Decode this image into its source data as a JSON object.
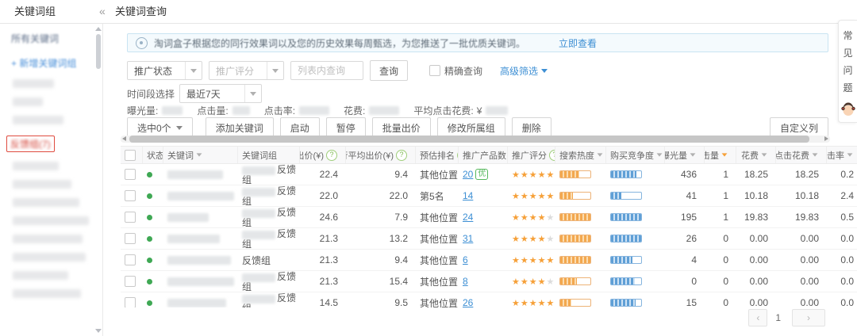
{
  "icons": {
    "help_glyph": "?",
    "status_dot_color": "#3fa854",
    "star_color": "#f6a038",
    "link_color": "#3d8fd4"
  },
  "header": {
    "sidebar_title": "关键词组",
    "collapse_icon": "«",
    "page_title": "关键词查询"
  },
  "sidebar": {
    "all_keywords": "所有关键词",
    "new_group": "+ 新增关键词组",
    "highlighted_item": "反馈组(7)"
  },
  "help_tab": {
    "label": "常见问题"
  },
  "banner": {
    "text": "淘词盒子根据您的同行效果词以及您的历史效果每周甄选，为您推送了一批优质关键词。",
    "link": "立即查看"
  },
  "filters": {
    "status_value": "推广状态",
    "score_placeholder": "推广评分",
    "search_placeholder": "列表内查询",
    "query_button": "查询",
    "exact_label": "精确查询",
    "advanced_label": "高级筛选",
    "time_label": "时间段选择",
    "time_value": "最近7天"
  },
  "summary": {
    "impressions_label": "曝光量:",
    "clicks_label": "点击量:",
    "ctr_label": "点击率:",
    "cost_label": "花费:",
    "avg_cost_label": "平均点击花费:",
    "currency": "¥"
  },
  "toolbar": {
    "selected_label": "选中0个",
    "buttons": [
      "添加关键词",
      "启动",
      "暂停",
      "批量出价",
      "修改所属组",
      "删除"
    ],
    "customize_label": "自定义列"
  },
  "table": {
    "columns": [
      {
        "key": "checkbox",
        "label": ""
      },
      {
        "key": "status",
        "label": "状态"
      },
      {
        "key": "keyword",
        "label": "关键词",
        "sort": "grey"
      },
      {
        "key": "group",
        "label": "关键词组"
      },
      {
        "key": "bid",
        "label": "出价(¥)",
        "help": true,
        "align": "right"
      },
      {
        "key": "peer_bid",
        "label": "同行平均出价(¥)",
        "help": true,
        "align": "right"
      },
      {
        "key": "rank",
        "label": "预估排名",
        "help": true
      },
      {
        "key": "products",
        "label": "推广产品数",
        "help": true
      },
      {
        "key": "score",
        "label": "推广评分",
        "help": true
      },
      {
        "key": "heat",
        "label": "搜索热度",
        "sort": "grey",
        "help": true
      },
      {
        "key": "competition",
        "label": "购买竞争度",
        "sort": "grey",
        "help": true
      },
      {
        "key": "impressions",
        "label": "曝光量",
        "sort": "grey",
        "align": "right"
      },
      {
        "key": "clicks",
        "label": "点击量",
        "sort": "orange",
        "align": "right"
      },
      {
        "key": "cost",
        "label": "花费",
        "sort": "grey",
        "align": "right"
      },
      {
        "key": "avg_cost",
        "label": "平均点击花费",
        "sort": "grey",
        "align": "right"
      },
      {
        "key": "ctr",
        "label": "点击率",
        "sort": "grey",
        "align": "right"
      }
    ],
    "group_suffix": "反馈组",
    "rows": [
      {
        "kw_blur_w": 70,
        "group_blurred": true,
        "bid": "22.4",
        "peer_bid": "9.4",
        "rank": "其他位置",
        "products": "20",
        "badge": "优",
        "stars": 5,
        "heat": 62,
        "competition": 84,
        "impressions": "436",
        "clicks": "1",
        "cost": "18.25",
        "avg_cost": "18.25",
        "ctr": "0.2"
      },
      {
        "kw_blur_w": 84,
        "group_blurred": true,
        "bid": "22.0",
        "peer_bid": "22.0",
        "rank": "第5名",
        "products": "14",
        "badge": "",
        "stars": 5,
        "heat": 42,
        "competition": 33,
        "impressions": "41",
        "clicks": "1",
        "cost": "10.18",
        "avg_cost": "10.18",
        "ctr": "2.4"
      },
      {
        "kw_blur_w": 52,
        "group_blurred": true,
        "bid": "24.6",
        "peer_bid": "7.9",
        "rank": "其他位置",
        "products": "24",
        "badge": "",
        "stars": 4,
        "heat": 100,
        "competition": 100,
        "impressions": "195",
        "clicks": "1",
        "cost": "19.83",
        "avg_cost": "19.83",
        "ctr": "0.5"
      },
      {
        "kw_blur_w": 66,
        "group_blurred": true,
        "bid": "21.3",
        "peer_bid": "13.2",
        "rank": "其他位置",
        "products": "31",
        "badge": "",
        "stars": 4,
        "heat": 100,
        "competition": 100,
        "impressions": "26",
        "clicks": "0",
        "cost": "0.00",
        "avg_cost": "0.00",
        "ctr": "0.0"
      },
      {
        "kw_blur_w": 80,
        "group_blurred": false,
        "bid": "21.3",
        "peer_bid": "9.4",
        "rank": "其他位置",
        "products": "6",
        "badge": "",
        "stars": 5,
        "heat": 100,
        "competition": 72,
        "impressions": "4",
        "clicks": "0",
        "cost": "0.00",
        "avg_cost": "0.00",
        "ctr": "0.0"
      },
      {
        "kw_blur_w": 84,
        "group_blurred": true,
        "bid": "21.3",
        "peer_bid": "15.4",
        "rank": "其他位置",
        "products": "8",
        "badge": "",
        "stars": 4,
        "heat": 55,
        "competition": 78,
        "impressions": "0",
        "clicks": "0",
        "cost": "0.00",
        "avg_cost": "0.00",
        "ctr": "0.0"
      },
      {
        "kw_blur_w": 74,
        "group_blurred": true,
        "bid": "14.5",
        "peer_bid": "9.5",
        "rank": "其他位置",
        "products": "26",
        "badge": "",
        "stars": 5,
        "heat": 38,
        "competition": 82,
        "impressions": "15",
        "clicks": "0",
        "cost": "0.00",
        "avg_cost": "0.00",
        "ctr": "0.0"
      }
    ]
  },
  "pagination": {
    "prev": "‹",
    "current": "1",
    "next": "›"
  }
}
